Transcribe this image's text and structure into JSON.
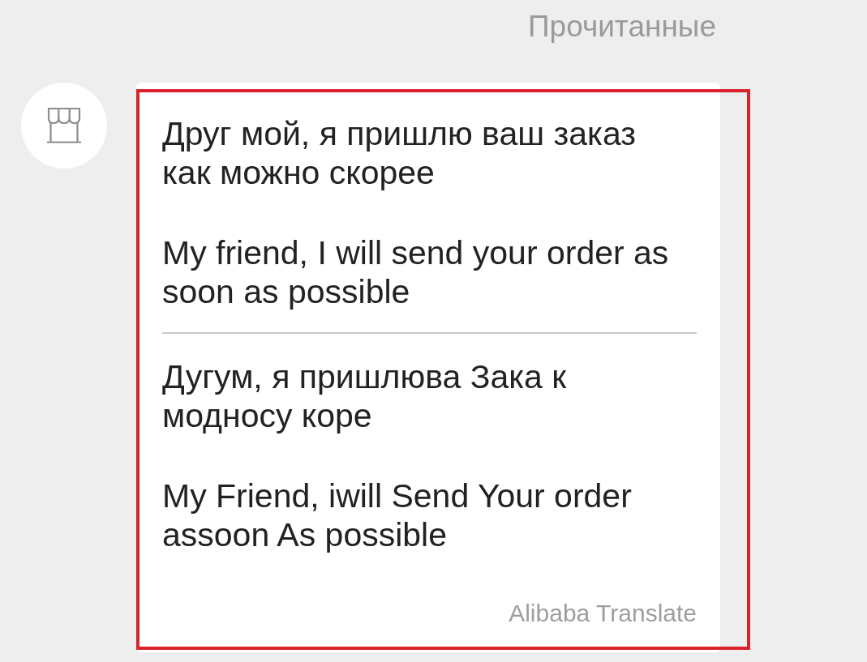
{
  "status": {
    "label": "Прочитанные"
  },
  "message": {
    "highlighted": true,
    "sections": [
      {
        "paragraphs": [
          "Друг мой, я пришлю ваш заказ как можно скорее",
          "My friend, I will send your order as soon as possible"
        ]
      },
      {
        "paragraphs": [
          "Дугум, я пришлюва Зака к модносу коре",
          "My Friend, iwill Send Your order assoon As possible"
        ]
      }
    ],
    "attribution": "Alibaba Translate"
  }
}
